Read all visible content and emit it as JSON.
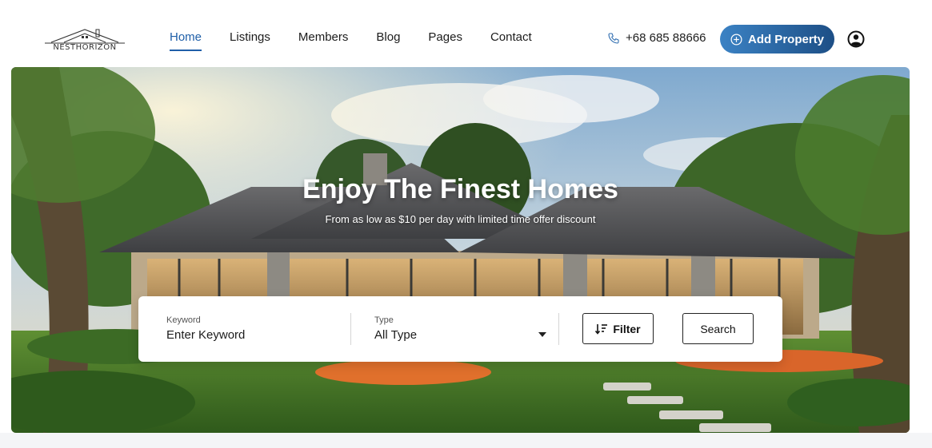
{
  "brand": {
    "logo_text": "NESTHORIZON"
  },
  "nav": {
    "items": [
      {
        "label": "Home",
        "active": true
      },
      {
        "label": "Listings",
        "active": false
      },
      {
        "label": "Members",
        "active": false
      },
      {
        "label": "Blog",
        "active": false
      },
      {
        "label": "Pages",
        "active": false
      },
      {
        "label": "Contact",
        "active": false
      }
    ]
  },
  "header": {
    "phone": "+68 685 88666",
    "phone_icon": "phone-icon",
    "add_property_label": "Add Property",
    "add_icon": "plus-circle-icon",
    "user_icon": "user-circle-icon"
  },
  "hero": {
    "title": "Enjoy The Finest Homes",
    "subtitle": "From as low as $10 per day with limited time offer discount"
  },
  "search": {
    "keyword_label": "Keyword",
    "keyword_placeholder": "Enter Keyword",
    "type_label": "Type",
    "type_value": "All Type",
    "filter_label": "Filter",
    "filter_icon": "sort-filter-icon",
    "search_label": "Search"
  },
  "colors": {
    "accent": "#1f5fa8",
    "button_gradient_start": "#3b82c4",
    "button_gradient_end": "#1d4f86"
  }
}
